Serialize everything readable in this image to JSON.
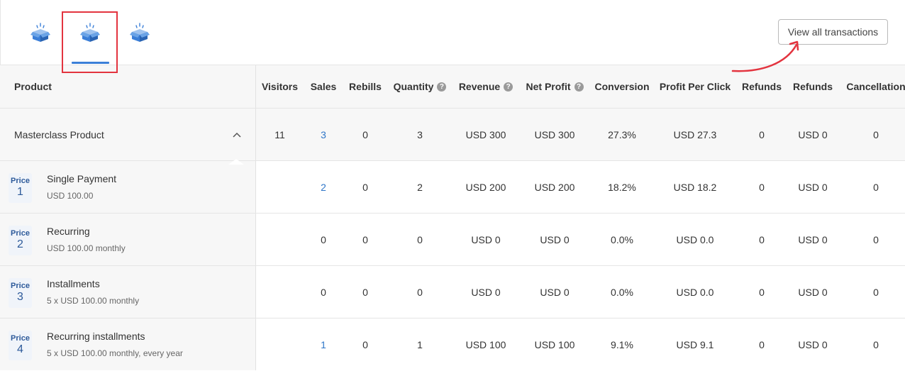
{
  "header": {
    "view_all_label": "View all transactions"
  },
  "icons": [
    "box-open-icon",
    "box-open-icon",
    "box-open-icon"
  ],
  "colors": {
    "accent": "#3b7fd8",
    "highlight": "#e3343f",
    "link": "#2f76c8"
  },
  "columns": {
    "product": "Product",
    "visitors": "Visitors",
    "sales": "Sales",
    "rebills": "Rebills",
    "quantity": "Quantity",
    "revenue": "Revenue",
    "net_profit": "Net Profit",
    "conversion": "Conversion",
    "profit_per_click": "Profit Per Click",
    "refunds1": "Refunds",
    "refunds2": "Refunds",
    "cancellation": "Cancellation",
    "help_glyph": "?"
  },
  "product": {
    "name": "Masterclass Product",
    "visitors": "11",
    "sales": "3",
    "rebills": "0",
    "quantity": "3",
    "revenue": "USD 300",
    "net_profit": "USD 300",
    "conversion": "27.3%",
    "profit_per_click": "USD 27.3",
    "refunds_count": "0",
    "refunds_amount": "USD 0",
    "cancellation": "0"
  },
  "price_label": "Price",
  "prices": [
    {
      "num": "1",
      "name": "Single Payment",
      "sub": "USD 100.00",
      "sales": "2",
      "rebills": "0",
      "quantity": "2",
      "revenue": "USD 200",
      "net_profit": "USD 200",
      "conversion": "18.2%",
      "profit_per_click": "USD 18.2",
      "refunds_count": "0",
      "refunds_amount": "USD 0",
      "cancellation": "0"
    },
    {
      "num": "2",
      "name": "Recurring",
      "sub": "USD 100.00 monthly",
      "sales": "0",
      "rebills": "0",
      "quantity": "0",
      "revenue": "USD 0",
      "net_profit": "USD 0",
      "conversion": "0.0%",
      "profit_per_click": "USD 0.0",
      "refunds_count": "0",
      "refunds_amount": "USD 0",
      "cancellation": "0"
    },
    {
      "num": "3",
      "name": "Installments",
      "sub": "5 x USD 100.00 monthly",
      "sales": "0",
      "rebills": "0",
      "quantity": "0",
      "revenue": "USD 0",
      "net_profit": "USD 0",
      "conversion": "0.0%",
      "profit_per_click": "USD 0.0",
      "refunds_count": "0",
      "refunds_amount": "USD 0",
      "cancellation": "0"
    },
    {
      "num": "4",
      "name": "Recurring installments",
      "sub": "5 x USD 100.00 monthly, every year",
      "sales": "1",
      "rebills": "0",
      "quantity": "1",
      "revenue": "USD 100",
      "net_profit": "USD 100",
      "conversion": "9.1%",
      "profit_per_click": "USD 9.1",
      "refunds_count": "0",
      "refunds_amount": "USD 0",
      "cancellation": "0"
    }
  ]
}
